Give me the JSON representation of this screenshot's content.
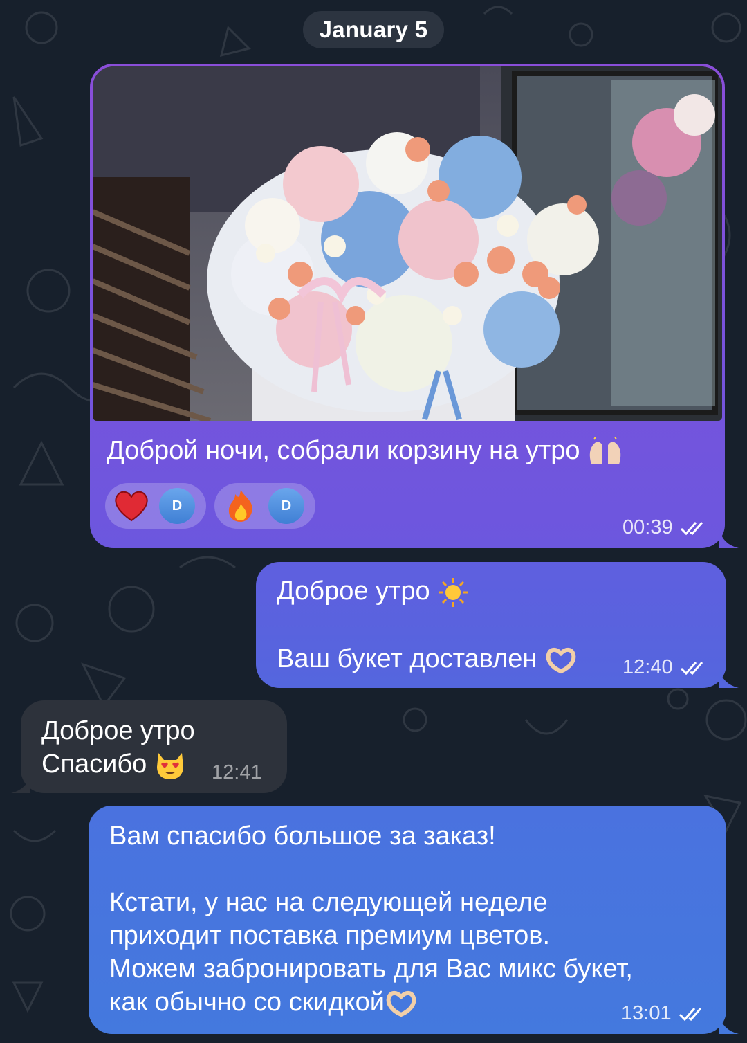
{
  "date_separator": "January 5",
  "messages": [
    {
      "direction": "outgoing",
      "type": "photo",
      "caption": "Доброй ночи, собрали корзину на утро",
      "caption_emoji": "raised-hands-icon",
      "reactions": [
        {
          "emoji": "red-heart-icon",
          "avatar_initial": "D"
        },
        {
          "emoji": "fire-icon",
          "avatar_initial": "D"
        }
      ],
      "time": "00:39",
      "status": "read"
    },
    {
      "direction": "outgoing",
      "line1": "Доброе утро",
      "line1_emoji": "sun-icon",
      "line2": "Ваш букет доставлен",
      "line2_emoji": "heart-hands-icon",
      "time": "12:40",
      "status": "read"
    },
    {
      "direction": "incoming",
      "line1": "Доброе утро",
      "line2": "Спасибо",
      "line2_emoji": "heart-eyes-cat-icon",
      "time": "12:41"
    },
    {
      "direction": "outgoing",
      "line1": "Вам спасибо большое за заказ!",
      "line2": "Кстати, у нас на следующей неделе",
      "line3": "приходит поставка премиум цветов.",
      "line4": "Можем забронировать для Вас микс букет,",
      "line5": "как обычно со скидкой",
      "line5_emoji": "heart-hands-icon",
      "time": "13:01",
      "status": "read"
    }
  ],
  "colors": {
    "background": "#17202c",
    "bubble_out_top": "#8a4ed9",
    "bubble_out_bottom": "#4479de",
    "bubble_in": "#2d323b",
    "date_pill": "#2c3440"
  }
}
